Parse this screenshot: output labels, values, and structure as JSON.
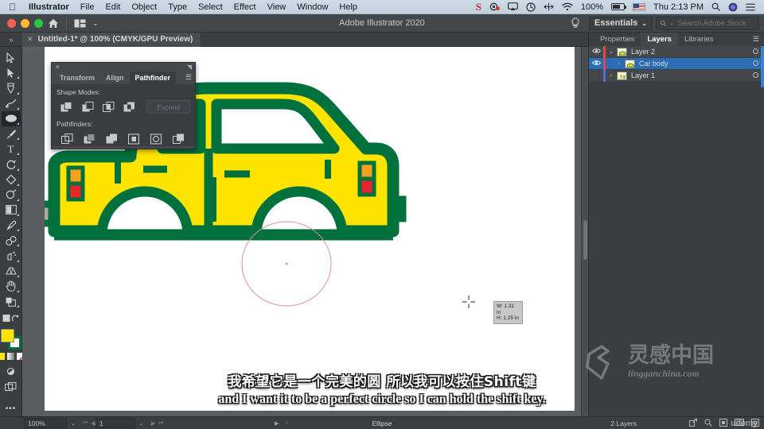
{
  "menubar": {
    "apple_icon": "apple-logo-icon",
    "items": [
      {
        "label": "Illustrator",
        "bold": true
      },
      {
        "label": "File",
        "bold": false
      },
      {
        "label": "Edit",
        "bold": false
      },
      {
        "label": "Object",
        "bold": false
      },
      {
        "label": "Type",
        "bold": false
      },
      {
        "label": "Select",
        "bold": false
      },
      {
        "label": "Effect",
        "bold": false
      },
      {
        "label": "View",
        "bold": false
      },
      {
        "label": "Window",
        "bold": false
      },
      {
        "label": "Help",
        "bold": false
      }
    ],
    "status_items": [
      {
        "name": "skype-icon",
        "glyph": "S"
      },
      {
        "name": "camera-icon",
        "glyph": "◉"
      },
      {
        "name": "airplay-icon",
        "glyph": "▭"
      },
      {
        "name": "time-machine-icon",
        "glyph": "◷"
      },
      {
        "name": "resolution-icon",
        "glyph": "✛"
      },
      {
        "name": "wifi-icon",
        "glyph": "◗"
      }
    ],
    "battery_percent": "100%",
    "input_flag": "us-flag-icon",
    "clock": "Thu 2:13 PM",
    "spotlight_icon": "search-icon",
    "siri_icon": "siri-icon",
    "control_center_icon": "list-icon"
  },
  "titlebar": {
    "app_title": "Adobe Illustrator 2020",
    "home_icon": "home-icon",
    "arrange_icon": "arrange-documents-icon",
    "arrange_caret": "⌄",
    "search_hint_icon": "lightbulb-icon",
    "workspace": "Essentials",
    "workspace_caret": "⌄",
    "stock_search_placeholder": "Search Adobe Stock",
    "stock_search_value": "",
    "stock_search_icon": "search-icon"
  },
  "document_tab": {
    "close_glyph": "✕",
    "title": "Untitled-1* @ 100% (CMYK/GPU Preview)",
    "collapse_glyph": "»"
  },
  "toolbar": {
    "tools": [
      {
        "name": "selection-tool",
        "glyph": "▷",
        "active": false,
        "corner": false
      },
      {
        "name": "direct-selection-tool",
        "glyph": "▶",
        "active": false,
        "corner": true
      },
      {
        "name": "pen-tool",
        "glyph": "✒",
        "active": false,
        "corner": true
      },
      {
        "name": "curvature-tool",
        "glyph": "✐",
        "active": false,
        "corner": true
      },
      {
        "name": "ellipse-tool",
        "glyph": "⬭",
        "active": true,
        "corner": true
      },
      {
        "name": "paintbrush-tool",
        "glyph": "🖌",
        "active": false,
        "corner": true
      },
      {
        "name": "type-tool",
        "glyph": "T",
        "active": false,
        "corner": true
      },
      {
        "name": "rotate-tool",
        "glyph": "↻",
        "active": false,
        "corner": true
      },
      {
        "name": "shaper-tool",
        "glyph": "◆",
        "active": false,
        "corner": true
      },
      {
        "name": "width-tool",
        "glyph": "◔",
        "active": false,
        "corner": true
      },
      {
        "name": "gradient-tool",
        "glyph": "▥",
        "active": false,
        "corner": true
      },
      {
        "name": "eyedropper-tool",
        "glyph": "⚲",
        "active": false,
        "corner": true
      },
      {
        "name": "blend-tool",
        "glyph": "⁂",
        "active": false,
        "corner": true
      },
      {
        "name": "symbol-sprayer-tool",
        "glyph": "❋",
        "active": false,
        "corner": true
      },
      {
        "name": "perspective-grid-tool",
        "glyph": "⌗",
        "active": false,
        "corner": true
      },
      {
        "name": "artboard-tool",
        "glyph": "⊡",
        "active": false,
        "corner": true
      },
      {
        "name": "hand-tool",
        "glyph": "✋",
        "active": false,
        "corner": true
      }
    ],
    "screen_mode_icon": "screen-mode-icon",
    "undo_icon": "change-screen-mode-icon",
    "fill_color": "#ffe400",
    "stroke_color": "#00703c",
    "more_tools_glyph": "•••"
  },
  "pathfinder_panel": {
    "close_glyph": "✕",
    "collapse_glyph": "◥",
    "menu_glyph": "☰",
    "tabs": [
      {
        "label": "Transform",
        "active": false
      },
      {
        "label": "Align",
        "active": false
      },
      {
        "label": "Pathfinder",
        "active": true
      }
    ],
    "shape_modes_label": "Shape Modes:",
    "shape_mode_buttons": [
      {
        "name": "unite-button"
      },
      {
        "name": "minus-front-button"
      },
      {
        "name": "intersect-button"
      },
      {
        "name": "exclude-button"
      }
    ],
    "expand_label": "Expand",
    "pathfinders_label": "Pathfinders:",
    "pathfinder_buttons": [
      {
        "name": "divide-button"
      },
      {
        "name": "trim-button"
      },
      {
        "name": "merge-button"
      },
      {
        "name": "crop-button"
      },
      {
        "name": "outline-button"
      },
      {
        "name": "minus-back-button"
      }
    ]
  },
  "canvas": {
    "measure_width": "W: 1.31 in",
    "measure_height": "H: 1.25 in",
    "shape_fill": "#ffe400",
    "shape_stroke": "#00703c",
    "taillight_orange": "#f5a01e",
    "taillight_red": "#e8252a",
    "bumper_gray": "#a8acaa",
    "preview_stroke": "#e08f9f"
  },
  "layers_panel": {
    "tabs": [
      {
        "label": "Properties",
        "active": false
      },
      {
        "label": "Layers",
        "active": true
      },
      {
        "label": "Libraries",
        "active": false
      }
    ],
    "menu_glyph": "☰",
    "rows": [
      {
        "name": "Layer 2",
        "selected": false,
        "visible": true,
        "color": "#e4464b",
        "indent": 0,
        "arrow": "⌄"
      },
      {
        "name": "Car body",
        "selected": true,
        "visible": true,
        "color": "#e4464b",
        "indent": 1,
        "arrow": "›"
      },
      {
        "name": "Layer 1",
        "selected": false,
        "visible": false,
        "color": "#4a6fd4",
        "indent": 0,
        "arrow": "›"
      }
    ]
  },
  "statusbar": {
    "zoom": "100%",
    "zoom_caret": "⌄",
    "first_glyph": "⏮",
    "prev_glyph": "◀",
    "page": "1",
    "page_caret": "⌄",
    "next_glyph": "▶",
    "last_glyph": "⏭",
    "current_tool": "Ellipse",
    "play_glyph": "▶",
    "back_glyph": "‹",
    "layer_count": "2 Layers",
    "right_icons": [
      {
        "name": "share-icon",
        "glyph": "⇗"
      },
      {
        "name": "search-icon",
        "glyph": "⌕"
      },
      {
        "name": "artboard-icon",
        "glyph": "▣"
      },
      {
        "name": "presentation-icon",
        "glyph": "▤"
      },
      {
        "name": "fit-artboard-icon",
        "glyph": "⊡"
      }
    ]
  },
  "subtitles": {
    "chinese": "我希望它是一个完美的圆 所以我可以按住Shift键",
    "english": "and I want it to be a perfect circle so I can hold the shift key."
  },
  "watermark": {
    "logo_icon": "lingganchina-logo-icon",
    "chinese": "灵感中国",
    "url": "lingganchina.com",
    "course_platform": "udemy"
  }
}
